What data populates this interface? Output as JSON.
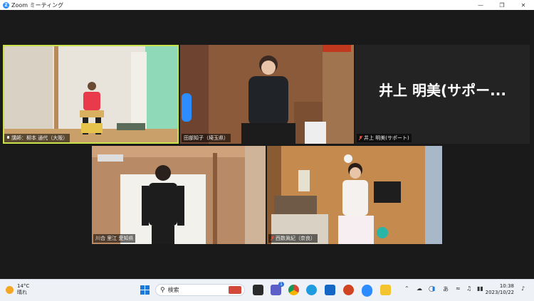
{
  "window": {
    "title": "Zoom ミーティング",
    "app_icon_letter": "Z"
  },
  "tiles": [
    {
      "id": "speaker",
      "label": "講師：柳本 通代（大阪）"
    },
    {
      "id": "tanabe",
      "label": "田部知子（埼玉県）"
    },
    {
      "id": "inoue",
      "label": "井上 明美(サポート)",
      "display_name": "井上 明美(サポー..."
    },
    {
      "id": "kawai",
      "label": "川合 里江 愛知県"
    },
    {
      "id": "nishimura",
      "label": "西数眞紀（奈良）"
    }
  ],
  "taskbar": {
    "weather_temp": "14°C",
    "weather_desc": "晴れ",
    "search_placeholder": "検索",
    "teams_badge": "1",
    "ime_mode": "あ",
    "time": "10:38",
    "date": "2023/10/22"
  },
  "colors": {
    "active_speaker": "#c8e34a",
    "zoom_blue": "#2d8cff"
  }
}
